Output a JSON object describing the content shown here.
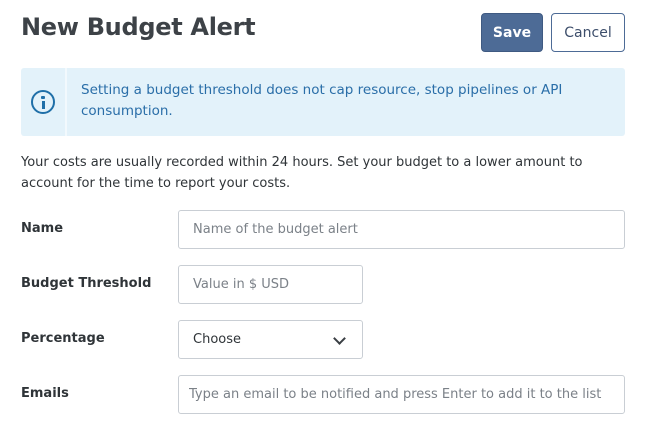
{
  "page": {
    "title": "New Budget Alert"
  },
  "toolbar": {
    "save_label": "Save",
    "cancel_label": "Cancel"
  },
  "alert": {
    "icon": "info-icon",
    "message": "Setting a budget threshold does not cap resource, stop pipelines or API consumption."
  },
  "description": "Your costs are usually recorded within 24 hours. Set your budget to a lower amount to account for the time to report your costs.",
  "form": {
    "name": {
      "label": "Name",
      "placeholder": "Name of the budget alert",
      "value": ""
    },
    "budget_threshold": {
      "label": "Budget Threshold",
      "placeholder": "Value in $ USD",
      "value": ""
    },
    "percentage": {
      "label": "Percentage",
      "selected": "Choose",
      "icon": "chevron-down-icon"
    },
    "emails": {
      "label": "Emails",
      "placeholder": "Type an email to be notified and press Enter to add it to the list",
      "value": ""
    }
  },
  "colors": {
    "primary": "#4d6b96",
    "alert_bg": "#e3f2fa",
    "alert_text": "#2a6ea8"
  }
}
